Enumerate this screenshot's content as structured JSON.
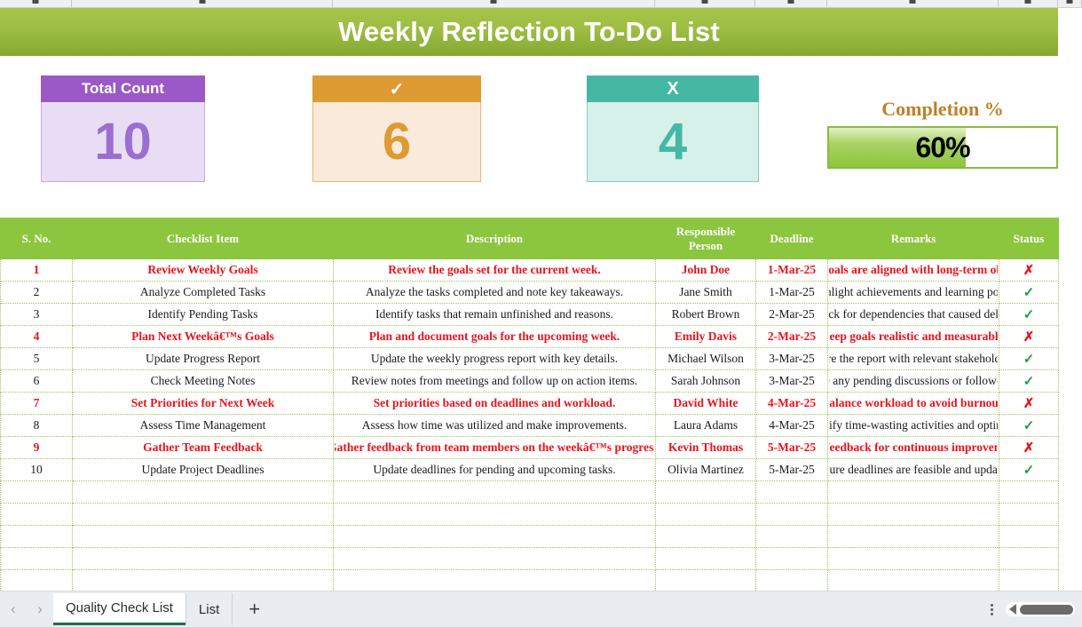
{
  "title": "Weekly Reflection To-Do List",
  "top_strip": {
    "column_count": 8
  },
  "kpis": {
    "total": {
      "label": "Total Count",
      "value": "10"
    },
    "completed": {
      "label": "✓",
      "value": "6"
    },
    "pending": {
      "label": "X",
      "value": "4"
    }
  },
  "completion": {
    "label": "Completion %",
    "value": "60%",
    "percent": 60,
    "label_color": "#c07f28",
    "fill_color": "#8cc63e"
  },
  "table": {
    "headers": [
      "S. No.",
      "Checklist Item",
      "Description",
      "Responsible Person",
      "Deadline",
      "Remarks",
      "Status"
    ],
    "header_bg": "#8cc63e",
    "highlight_color": "#e8141c",
    "rows": [
      {
        "no": "1",
        "item": "Review Weekly Goals",
        "desc": "Review the goals set for the current week.",
        "person": "John Doe",
        "deadline": "1-Mar-25",
        "remarks": "Ensure goals are aligned with long-term objectives.",
        "status": "✗",
        "status_type": "no",
        "highlight": true
      },
      {
        "no": "2",
        "item": "Analyze Completed Tasks",
        "desc": "Analyze the tasks completed and note key takeaways.",
        "person": "Jane Smith",
        "deadline": "1-Mar-25",
        "remarks": "Highlight achievements and learning points.",
        "status": "✓",
        "status_type": "ok",
        "highlight": false
      },
      {
        "no": "3",
        "item": "Identify Pending Tasks",
        "desc": "Identify tasks that remain unfinished and reasons.",
        "person": "Robert Brown",
        "deadline": "2-Mar-25",
        "remarks": "Check for dependencies that caused delays.",
        "status": "✓",
        "status_type": "ok",
        "highlight": false
      },
      {
        "no": "4",
        "item": "Plan Next Weekâ€™s Goals",
        "desc": "Plan and document goals for the upcoming week.",
        "person": "Emily Davis",
        "deadline": "2-Mar-25",
        "remarks": "Keep goals realistic and measurable.",
        "status": "✗",
        "status_type": "no",
        "highlight": true
      },
      {
        "no": "5",
        "item": "Update Progress Report",
        "desc": "Update the weekly progress report with key details.",
        "person": "Michael Wilson",
        "deadline": "3-Mar-25",
        "remarks": "Share the report with relevant stakeholders.",
        "status": "✓",
        "status_type": "ok",
        "highlight": false
      },
      {
        "no": "6",
        "item": "Check Meeting Notes",
        "desc": "Review notes from meetings and follow up on action items.",
        "person": "Sarah Johnson",
        "deadline": "3-Mar-25",
        "remarks": "Note any pending discussions or follow-ups.",
        "status": "✓",
        "status_type": "ok",
        "highlight": false
      },
      {
        "no": "7",
        "item": "Set Priorities for Next Week",
        "desc": "Set priorities based on deadlines and workload.",
        "person": "David White",
        "deadline": "4-Mar-25",
        "remarks": "Balance workload to avoid burnout.",
        "status": "✗",
        "status_type": "no",
        "highlight": true
      },
      {
        "no": "8",
        "item": "Assess Time Management",
        "desc": "Assess how time was utilized and make improvements.",
        "person": "Laura Adams",
        "deadline": "4-Mar-25",
        "remarks": "Identify time-wasting activities and optimize.",
        "status": "✓",
        "status_type": "ok",
        "highlight": false
      },
      {
        "no": "9",
        "item": "Gather Team Feedback",
        "desc": "Gather feedback from team members on the weekâ€™s progress.",
        "person": "Kevin Thomas",
        "deadline": "5-Mar-25",
        "remarks": "Use feedback for continuous improvement.",
        "status": "✗",
        "status_type": "no",
        "highlight": true
      },
      {
        "no": "10",
        "item": "Update Project Deadlines",
        "desc": "Update deadlines for pending and upcoming tasks.",
        "person": "Olivia Martinez",
        "deadline": "5-Mar-25",
        "remarks": "Ensure deadlines are feasible and updated.",
        "status": "✓",
        "status_type": "ok",
        "highlight": false
      }
    ],
    "empty_row_count": 5
  },
  "sheet_bar": {
    "prev_arrow": "‹",
    "next_arrow": "›",
    "tabs": [
      {
        "label": "Quality Check List",
        "active": true
      },
      {
        "label": "List",
        "active": false
      }
    ],
    "add_label": "+",
    "options_icon": "vertical-dots-icon"
  }
}
